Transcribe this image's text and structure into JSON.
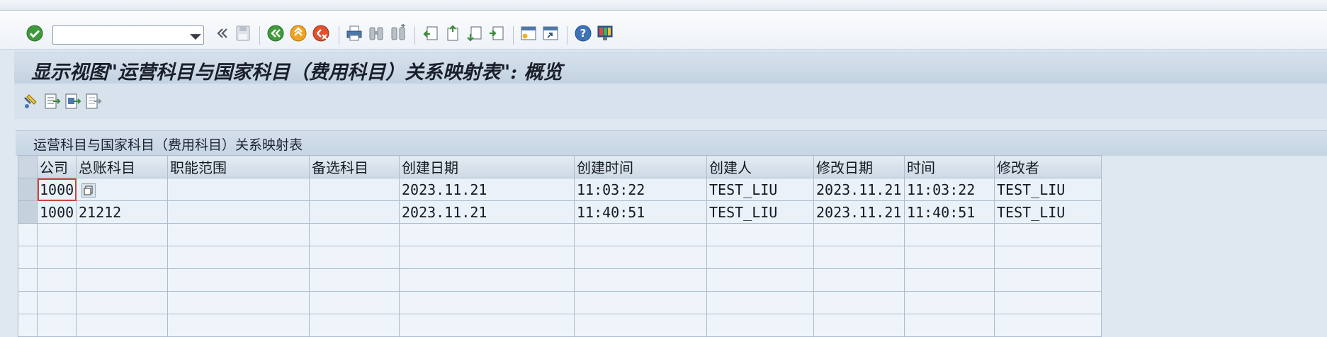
{
  "title": "显示视图\"运营科目与国家科目（费用科目）关系映射表\": 概览",
  "command_field": {
    "value": ""
  },
  "toolbar": {
    "icons": [
      "enter-icon",
      "command-dropdown-icon",
      "back-arrows-icon",
      "save-icon",
      "back-icon",
      "exit-icon",
      "cancel-icon",
      "print-icon",
      "find-icon",
      "find-next-icon",
      "first-page-icon",
      "previous-page-icon",
      "next-page-icon",
      "last-page-icon",
      "create-session-icon",
      "shortcut-icon",
      "help-icon",
      "customize-layout-icon"
    ]
  },
  "app_toolbar": {
    "icons": [
      "display-change-icon",
      "select-all-icon",
      "select-block-icon",
      "deselect-all-icon"
    ]
  },
  "table": {
    "caption": "运营科目与国家科目（费用科目）关系映射表",
    "columns": [
      "公司",
      "总账科目",
      "职能范围",
      "备选科目",
      "创建日期",
      "创建时间",
      "创建人",
      "修改日期",
      "时间",
      "修改者"
    ],
    "rows": [
      [
        "1000",
        "",
        "",
        "",
        "2023.11.21",
        "11:03:22",
        "TEST_LIU",
        "2023.11.21",
        "11:03:22",
        "TEST_LIU"
      ],
      [
        "1000",
        "21212",
        "",
        "",
        "2023.11.21",
        "11:40:51",
        "TEST_LIU",
        "2023.11.21",
        "11:40:51",
        "TEST_LIU"
      ]
    ],
    "empty_rows": 5
  },
  "colors": {
    "title_bar": "#c3d2e1",
    "grid_cell": "#eaf1f8",
    "focus": "#c6473d"
  }
}
